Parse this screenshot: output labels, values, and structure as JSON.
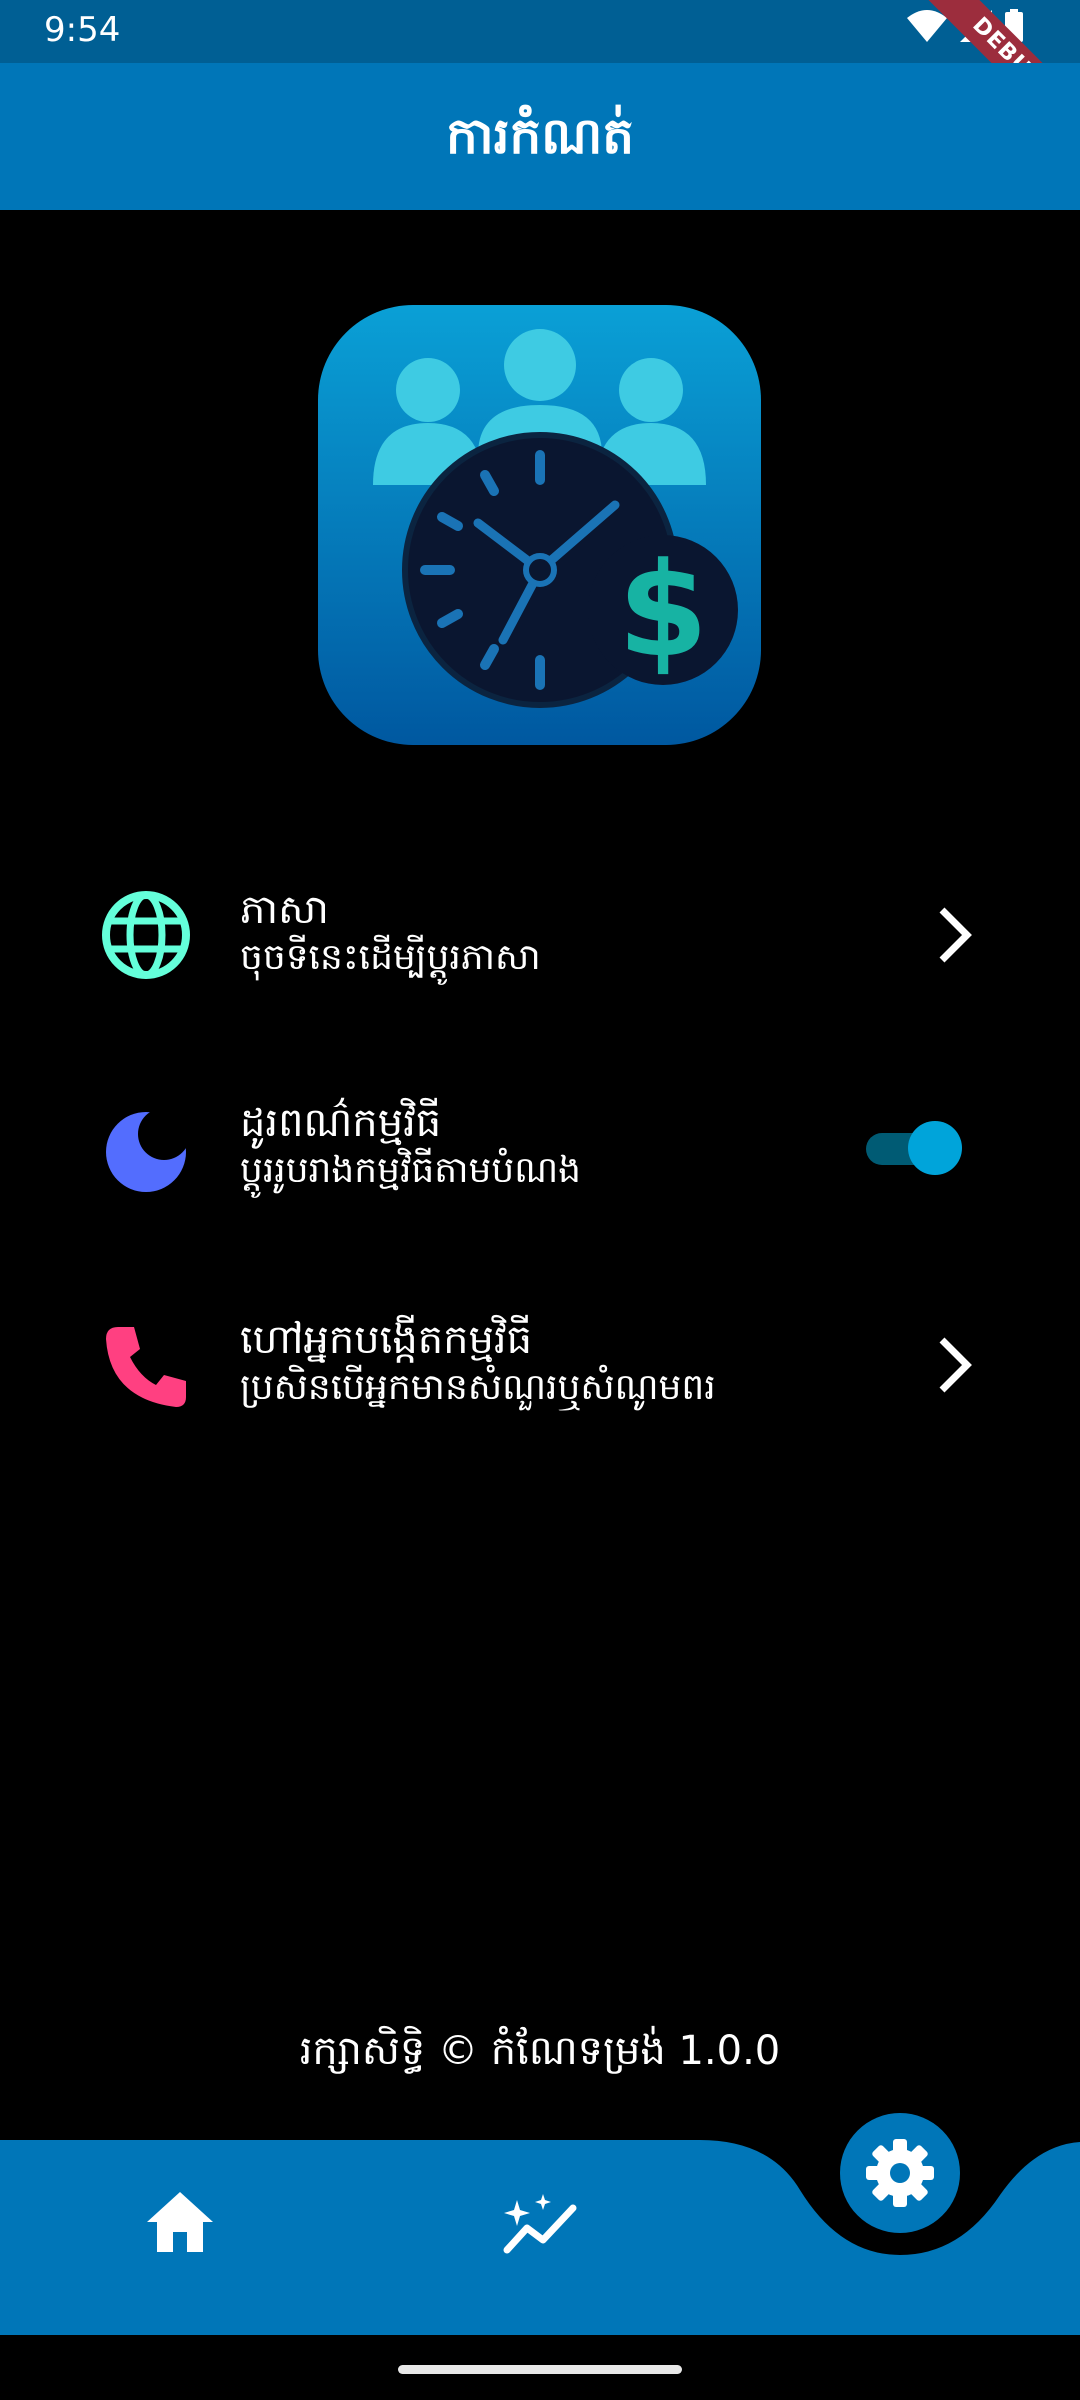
{
  "status_bar": {
    "time": "9:54",
    "debug_label": "DEBUG"
  },
  "app_bar": {
    "title": "ការកំណត់"
  },
  "settings": [
    {
      "title": "ភាសា",
      "subtitle": "ចុចទីនេះដើម្បីប្តូរភាសា",
      "icon": "globe-icon",
      "icon_color": "#64ffda",
      "action": "chevron"
    },
    {
      "title": "ដូរពណ៌កម្មវិធី",
      "subtitle": "ប្តូររូបរាងកម្មវិធីតាមបំណង",
      "icon": "moon-icon",
      "icon_color": "#536dfe",
      "action": "toggle",
      "toggle_on": true
    },
    {
      "title": "ហៅអ្នកបង្កើតកម្មវិធី",
      "subtitle": "ប្រសិនបើអ្នកមានសំណួរឬសំណូមពរ",
      "icon": "phone-icon",
      "icon_color": "#ff4081",
      "action": "chevron"
    }
  ],
  "footer": {
    "copyright": "រក្សាសិទ្ធិ © កំណែទម្រង់ 1.0.0"
  },
  "bottom_nav": {
    "items": [
      "home-icon",
      "insights-icon"
    ],
    "fab_icon": "gear-icon"
  },
  "colors": {
    "primary": "#0076b8",
    "status_bar": "#005f94",
    "background": "#000000",
    "toggle_active": "#00a4da"
  }
}
